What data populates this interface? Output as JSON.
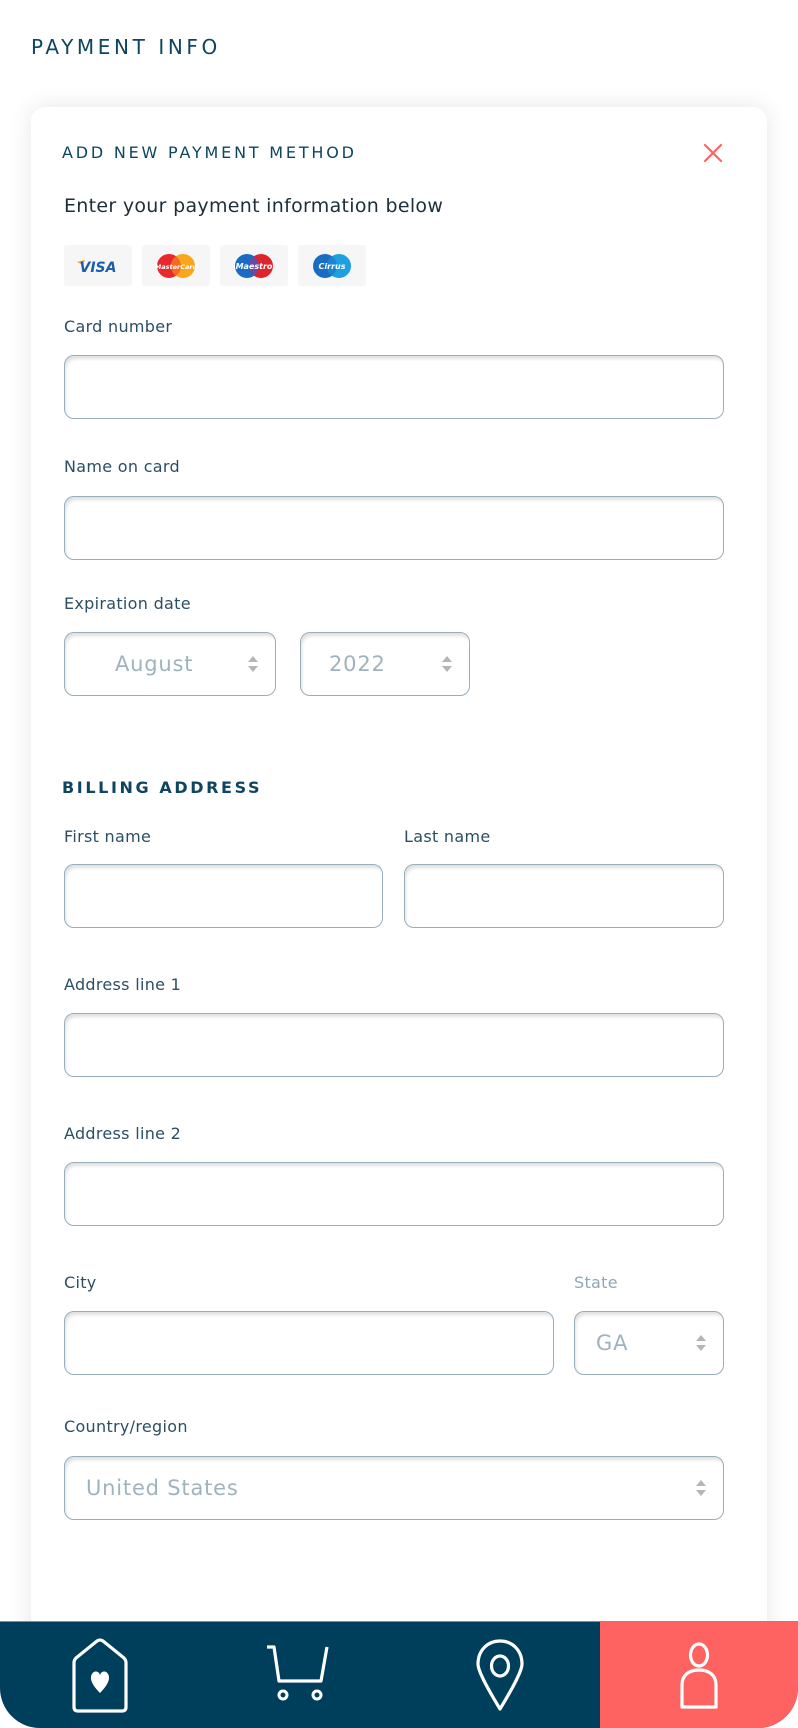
{
  "page": {
    "title": "PAYMENT INFO"
  },
  "card": {
    "title": "ADD NEW PAYMENT METHOD",
    "subtitle": "Enter your payment information below",
    "close_icon": "close-x-icon",
    "logos": [
      {
        "name": "visa",
        "label": "VISA"
      },
      {
        "name": "mastercard",
        "label": "MasterCard"
      },
      {
        "name": "maestro",
        "label": "Maestro"
      },
      {
        "name": "cirrus",
        "label": "Cirrus"
      }
    ]
  },
  "form": {
    "card_number": {
      "label": "Card number",
      "value": ""
    },
    "name_on_card": {
      "label": "Name on card",
      "value": ""
    },
    "expiration": {
      "label": "Expiration date",
      "month": "August",
      "year": "2022"
    }
  },
  "billing": {
    "title": "BILLING ADDRESS",
    "first_name": {
      "label": "First name",
      "value": ""
    },
    "last_name": {
      "label": "Last name",
      "value": ""
    },
    "address1": {
      "label": "Address line 1",
      "value": ""
    },
    "address2": {
      "label": "Address line 2",
      "value": ""
    },
    "city": {
      "label": "City",
      "value": ""
    },
    "state": {
      "label": "State",
      "value": "GA"
    },
    "country": {
      "label": "Country/region",
      "value": "United States"
    }
  },
  "nav": {
    "items": [
      {
        "name": "favorites",
        "icon": "tag-heart-icon",
        "active": false
      },
      {
        "name": "cart",
        "icon": "cart-icon",
        "active": false
      },
      {
        "name": "location",
        "icon": "map-pin-icon",
        "active": false
      },
      {
        "name": "profile",
        "icon": "person-icon",
        "active": true
      }
    ]
  },
  "colors": {
    "primary": "#003f5c",
    "accent": "#ff6361",
    "heading": "#0e4560",
    "input_border": "#98aebb",
    "muted_text": "#9fb3bf"
  }
}
